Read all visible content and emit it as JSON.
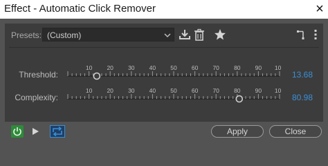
{
  "window": {
    "title": "Effect - Automatic Click Remover",
    "close_glyph": "×"
  },
  "presets": {
    "label": "Presets:",
    "selected": "(Custom)",
    "icons": [
      "dropdown-arrow-icon",
      "download-preset-icon",
      "trash-icon",
      "star-icon",
      "routing-icon",
      "more-icon"
    ]
  },
  "sliders": [
    {
      "label": "Threshold:",
      "value_text": "13.68",
      "value": 13.68,
      "min": 0,
      "max": 100,
      "tick_labels": [
        "10",
        "20",
        "30",
        "40",
        "50",
        "60",
        "70",
        "80",
        "90",
        "100"
      ]
    },
    {
      "label": "Complexity:",
      "value_text": "80.98",
      "value": 80.98,
      "min": 0,
      "max": 100,
      "tick_labels": [
        "10",
        "20",
        "30",
        "40",
        "50",
        "60",
        "70",
        "80",
        "90",
        "100"
      ]
    }
  ],
  "footer": {
    "apply_label": "Apply",
    "close_label": "Close",
    "icons": [
      "power-icon",
      "play-icon",
      "loop-icon"
    ]
  },
  "colors": {
    "accent": "#3a8fd6",
    "power_on": "#2e8b3a",
    "panel": "#3c3c3c",
    "background": "#535353"
  }
}
